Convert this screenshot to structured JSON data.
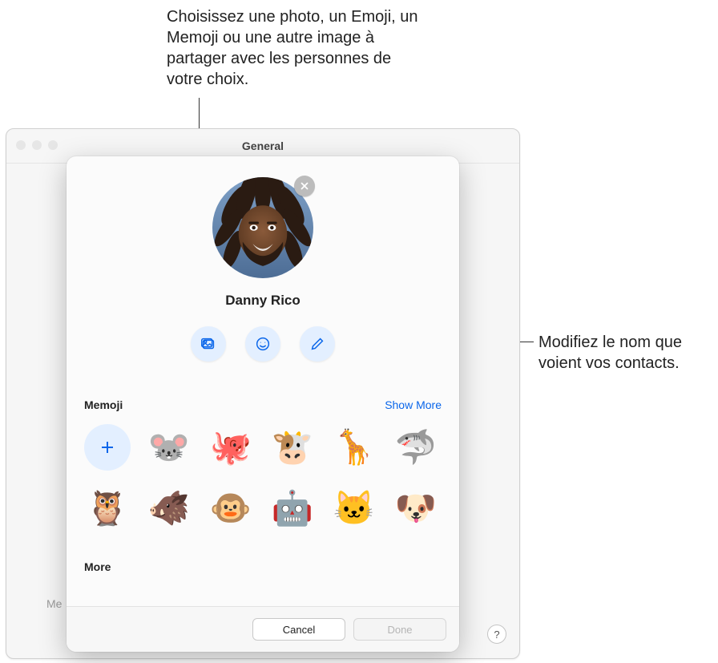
{
  "callouts": {
    "photo": "Choisissez une photo, un Emoji, un Memoji ou une autre image à partager avec les personnes de votre choix.",
    "name": "Modifiez le nom que voient vos contacts."
  },
  "window": {
    "title": "General",
    "dim_label": "Me",
    "help_glyph": "?"
  },
  "sheet": {
    "avatar_remove_name": "close-icon",
    "display_name": "Danny Rico",
    "actions": {
      "photo_name": "photo-picker-button",
      "emoji_name": "emoji-picker-button",
      "edit_name": "edit-name-button"
    },
    "memoji_section_title": "Memoji",
    "memoji_show_more": "Show More",
    "memoji_items": [
      {
        "emoji": "+",
        "name": "add-memoji-button",
        "is_add": true
      },
      {
        "emoji": "🐭",
        "name": "memoji-mouse"
      },
      {
        "emoji": "🐙",
        "name": "memoji-octopus"
      },
      {
        "emoji": "🐮",
        "name": "memoji-cow"
      },
      {
        "emoji": "🦒",
        "name": "memoji-giraffe"
      },
      {
        "emoji": "🦈",
        "name": "memoji-shark"
      },
      {
        "emoji": "🦉",
        "name": "memoji-owl"
      },
      {
        "emoji": "🐗",
        "name": "memoji-boar"
      },
      {
        "emoji": "🐵",
        "name": "memoji-monkey"
      },
      {
        "emoji": "🤖",
        "name": "memoji-robot"
      },
      {
        "emoji": "🐱",
        "name": "memoji-cat"
      },
      {
        "emoji": "🐶",
        "name": "memoji-dog"
      }
    ],
    "more_section_title": "More",
    "buttons": {
      "cancel": "Cancel",
      "done": "Done"
    }
  }
}
